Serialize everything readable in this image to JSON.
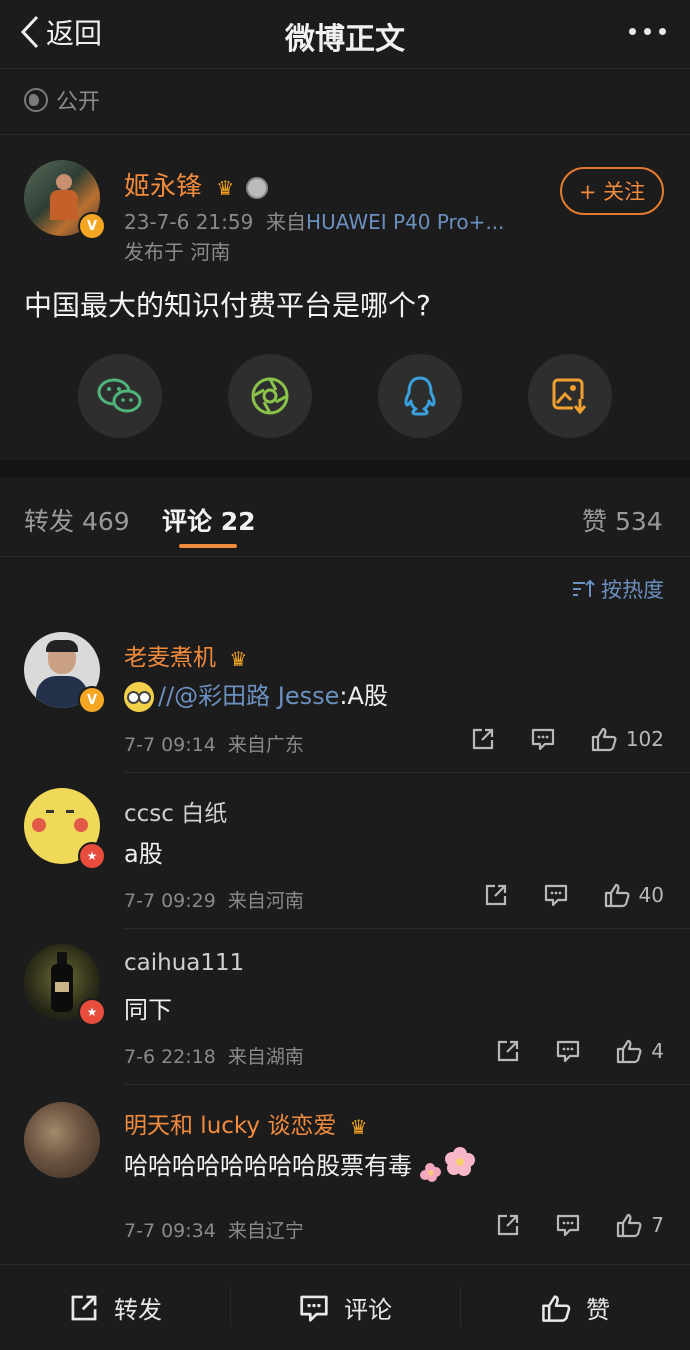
{
  "navbar": {
    "back_label": "返回",
    "title": "微博正文"
  },
  "post": {
    "visibility": "公开",
    "author": "姬永锋",
    "time": "23-7-6 21:59",
    "source_prefix": "来自",
    "device": "HUAWEI P40 Pro+...",
    "location": "发布于 河南",
    "follow_label": "+ 关注",
    "text": "中国最大的知识付费平台是哪个?"
  },
  "share_icons": [
    "wechat-icon",
    "moments-icon",
    "qq-icon",
    "save-image-icon"
  ],
  "tabs": {
    "repost": {
      "label": "转发",
      "count": "469"
    },
    "comment": {
      "label": "评论",
      "count": "22"
    },
    "like": {
      "label": "赞",
      "count": "534"
    }
  },
  "sort_label": "按热度",
  "comments": [
    {
      "name": "老麦煮机",
      "mention": "//@彩田路 Jesse",
      "text": ":A股",
      "time": "7-7 09:14",
      "source": "来自广东",
      "likes": "102"
    },
    {
      "name": "ccsc 白纸",
      "text": "a股",
      "time": "7-7 09:29",
      "source": "来自河南",
      "likes": "40"
    },
    {
      "name": "caihua111",
      "text": "同下",
      "time": "7-6 22:18",
      "source": "来自湖南",
      "likes": "4"
    },
    {
      "name": "明天和 lucky 谈恋爱",
      "text": "哈哈哈哈哈哈哈哈股票有毒",
      "time": "7-7 09:34",
      "source": "来自辽宁",
      "likes": "7"
    }
  ],
  "bottom_bar": {
    "repost": "转发",
    "comment": "评论",
    "like": "赞"
  },
  "colors": {
    "accent": "#f08a3c",
    "link": "#6b8fbf",
    "background": "#1c1c1c"
  }
}
